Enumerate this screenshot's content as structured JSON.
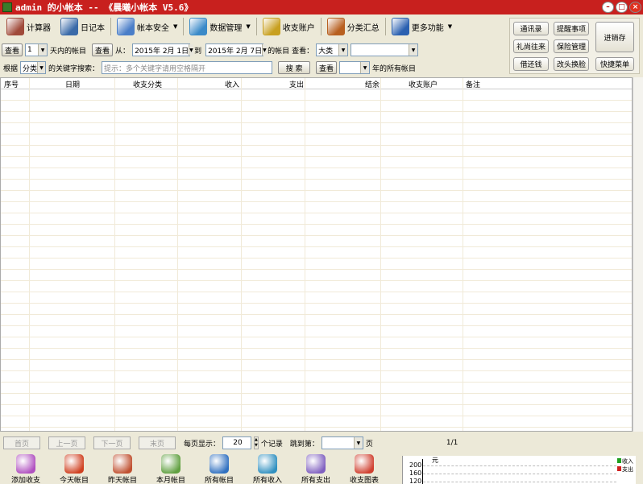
{
  "window": {
    "title": "admin 的小帐本 -- 《晨曦小帐本 V5.6》"
  },
  "toolbar": [
    {
      "label": "计算器",
      "icon": "calculator-icon",
      "color": "#a04a3a"
    },
    {
      "label": "日记本",
      "icon": "notebook-icon",
      "color": "#3a6aa8"
    },
    {
      "label": "帐本安全",
      "icon": "security-icon",
      "color": "#4a7ec8",
      "dropdown": true
    },
    {
      "label": "数据管理",
      "icon": "database-icon",
      "color": "#3a8ac8",
      "dropdown": true
    },
    {
      "label": "收支账户",
      "icon": "account-icon",
      "color": "#c8a020"
    },
    {
      "label": "分类汇总",
      "icon": "summary-icon",
      "color": "#b86020"
    },
    {
      "label": "更多功能",
      "icon": "more-icon",
      "color": "#2a60b0",
      "dropdown": true
    }
  ],
  "right_panel": {
    "buttons": [
      "通讯录",
      "提醒事项",
      "礼尚往来",
      "保险管理",
      "借还钱",
      "改头换脸",
      "快捷菜单"
    ],
    "big_button": "进销存"
  },
  "filter_row1": {
    "view_btn": "查看",
    "days_value": "1",
    "days_label": "天内的帐目",
    "view_btn2": "查看",
    "from_label": "从：",
    "from_date": "2015年 2月 1日",
    "to_label": "到",
    "to_date": "2015年 2月 7日",
    "range_label": "的帐目",
    "view_label": "查看：",
    "category_value": "大类",
    "sub_value": ""
  },
  "filter_row2": {
    "by_label": "根据",
    "field_value": "分类",
    "keyword_label": "的关键字搜索：",
    "search_placeholder": "提示：多个关键字请用空格隔开",
    "search_btn": "搜 索",
    "view_btn": "查看",
    "year_value": "",
    "year_label": "年的所有帐目"
  },
  "table": {
    "columns": [
      "序号",
      "日期",
      "收支分类",
      "收入",
      "支出",
      "结余",
      "收支账户",
      "备注"
    ]
  },
  "pager": {
    "first": "首页",
    "prev": "上一页",
    "next": "下一页",
    "last": "末页",
    "per_page_label": "每页显示：",
    "per_page_value": "20",
    "records_label": "个记录",
    "jump_label": "跳到第：",
    "jump_value": "",
    "page_label": "页",
    "page_info": "1/1"
  },
  "bottom_bar": [
    {
      "label": "添加收支",
      "icon": "add-record-icon",
      "color": "#b050c0"
    },
    {
      "label": "今天帐目",
      "icon": "today-icon",
      "color": "#d04020"
    },
    {
      "label": "昨天帐目",
      "icon": "yesterday-icon",
      "color": "#c05030"
    },
    {
      "label": "本月帐目",
      "icon": "month-icon",
      "color": "#60a040"
    },
    {
      "label": "所有帐目",
      "icon": "all-records-icon",
      "color": "#3070c0"
    },
    {
      "label": "所有收入",
      "icon": "all-income-icon",
      "color": "#3090c0"
    },
    {
      "label": "所有支出",
      "icon": "all-expense-icon",
      "color": "#8060c0"
    },
    {
      "label": "收支图表",
      "icon": "chart-icon",
      "color": "#d04030"
    }
  ],
  "mini_chart": {
    "unit": "元",
    "y_ticks": [
      "200",
      "160",
      "120"
    ],
    "legend": [
      {
        "label": "收入",
        "color": "#20a020"
      },
      {
        "label": "支出",
        "color": "#d02020"
      }
    ]
  }
}
